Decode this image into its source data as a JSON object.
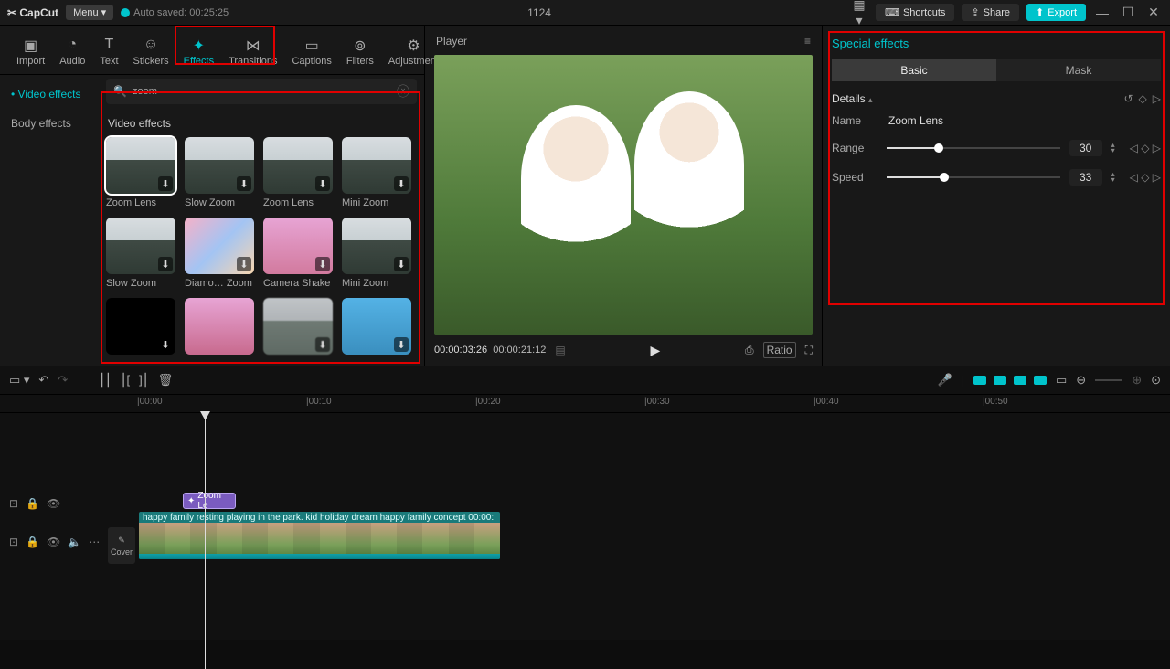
{
  "app": {
    "name": "CapCut",
    "menu": "Menu ▾",
    "autosave": "Auto saved: 00:25:25",
    "project": "1124"
  },
  "titlebar": {
    "shortcuts": "Shortcuts",
    "share": "Share",
    "export": "Export"
  },
  "toolTabs": [
    {
      "id": "import",
      "label": "Import"
    },
    {
      "id": "audio",
      "label": "Audio"
    },
    {
      "id": "text",
      "label": "Text"
    },
    {
      "id": "stickers",
      "label": "Stickers"
    },
    {
      "id": "effects",
      "label": "Effects"
    },
    {
      "id": "transitions",
      "label": "Transitions"
    },
    {
      "id": "captions",
      "label": "Captions"
    },
    {
      "id": "filters",
      "label": "Filters"
    },
    {
      "id": "adjustment",
      "label": "Adjustment"
    }
  ],
  "sideTabs": [
    {
      "label": "Video effects",
      "active": true
    },
    {
      "label": "Body effects",
      "active": false
    }
  ],
  "search": {
    "value": "zoom"
  },
  "section": {
    "title": "Video effects"
  },
  "effects": [
    {
      "label": "Zoom Lens",
      "thumb": "mountain",
      "dl": true,
      "selected": true
    },
    {
      "label": "Slow Zoom",
      "thumb": "mountain",
      "dl": true
    },
    {
      "label": "Zoom Lens",
      "thumb": "mountain",
      "dl": true
    },
    {
      "label": "Mini Zoom",
      "thumb": "mountain",
      "dl": true
    },
    {
      "label": "Slow Zoom",
      "thumb": "mountain",
      "dl": true
    },
    {
      "label": "Diamo… Zoom",
      "thumb": "bokeh",
      "dl": true
    },
    {
      "label": "Camera Shake",
      "thumb": "pink",
      "dl": true
    },
    {
      "label": "Mini Zoom",
      "thumb": "mountain",
      "dl": true
    },
    {
      "label": "",
      "thumb": "black",
      "dl": true
    },
    {
      "label": "",
      "thumb": "pink2",
      "dl": false
    },
    {
      "label": "",
      "thumb": "blurm",
      "dl": true
    },
    {
      "label": "",
      "thumb": "blue",
      "dl": true
    }
  ],
  "player": {
    "title": "Player",
    "current": "00:00:03:26",
    "duration": "00:00:21:12",
    "ratio": "Ratio"
  },
  "rightPanel": {
    "title": "Special effects",
    "tabs": {
      "basic": "Basic",
      "mask": "Mask"
    },
    "details": "Details",
    "nameLabel": "Name",
    "nameValue": "Zoom Lens",
    "params": [
      {
        "label": "Range",
        "value": 30,
        "pct": 30
      },
      {
        "label": "Speed",
        "value": 33,
        "pct": 33
      }
    ]
  },
  "ruler": [
    {
      "pos": 0,
      "label": "|00:00"
    },
    {
      "pos": 185,
      "label": "|00:10"
    },
    {
      "pos": 370,
      "label": "|00:20"
    },
    {
      "pos": 555,
      "label": "|00:30"
    },
    {
      "pos": 740,
      "label": "|00:40"
    },
    {
      "pos": 925,
      "label": "|00:50"
    }
  ],
  "timeline": {
    "fxClip": "Zoom Le",
    "clipTitle": "happy family resting playing in the park. kid holiday dream happy family concept   00:00:",
    "cover": "Cover"
  }
}
